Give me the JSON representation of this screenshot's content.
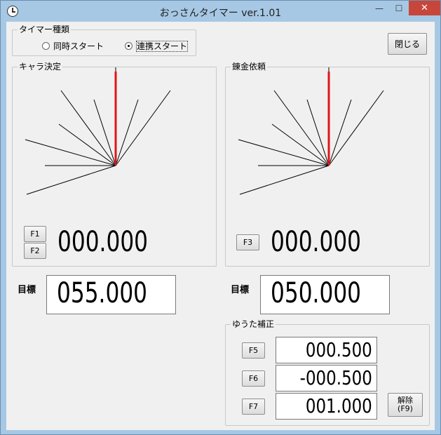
{
  "title": "おっさんタイマー ver.1.01",
  "timer_type": {
    "label": "タイマー種類",
    "options": [
      "同時スタート",
      "連携スタート"
    ],
    "selected": "連携スタート"
  },
  "close_button": "閉じる",
  "left_panel": {
    "label": "キャラ決定",
    "keys": [
      "F1",
      "F2"
    ],
    "display": "000.000"
  },
  "right_panel": {
    "label": "錬金依頼",
    "keys": [
      "F3"
    ],
    "display": "000.000"
  },
  "targets": {
    "label_left": "目標",
    "label_right": "目標",
    "left_value": "055.000",
    "right_value": "050.000"
  },
  "correction": {
    "label": "ゆうた補正",
    "rows": [
      {
        "key": "F5",
        "value": "000.500"
      },
      {
        "key": "F6",
        "value": "-000.500"
      },
      {
        "key": "F7",
        "value": "001.000"
      }
    ],
    "release_label": "解除 (F9)"
  },
  "colors": {
    "needle": "#e0141a",
    "titlebar": "#a6c8e4",
    "close": "#c7463b"
  }
}
